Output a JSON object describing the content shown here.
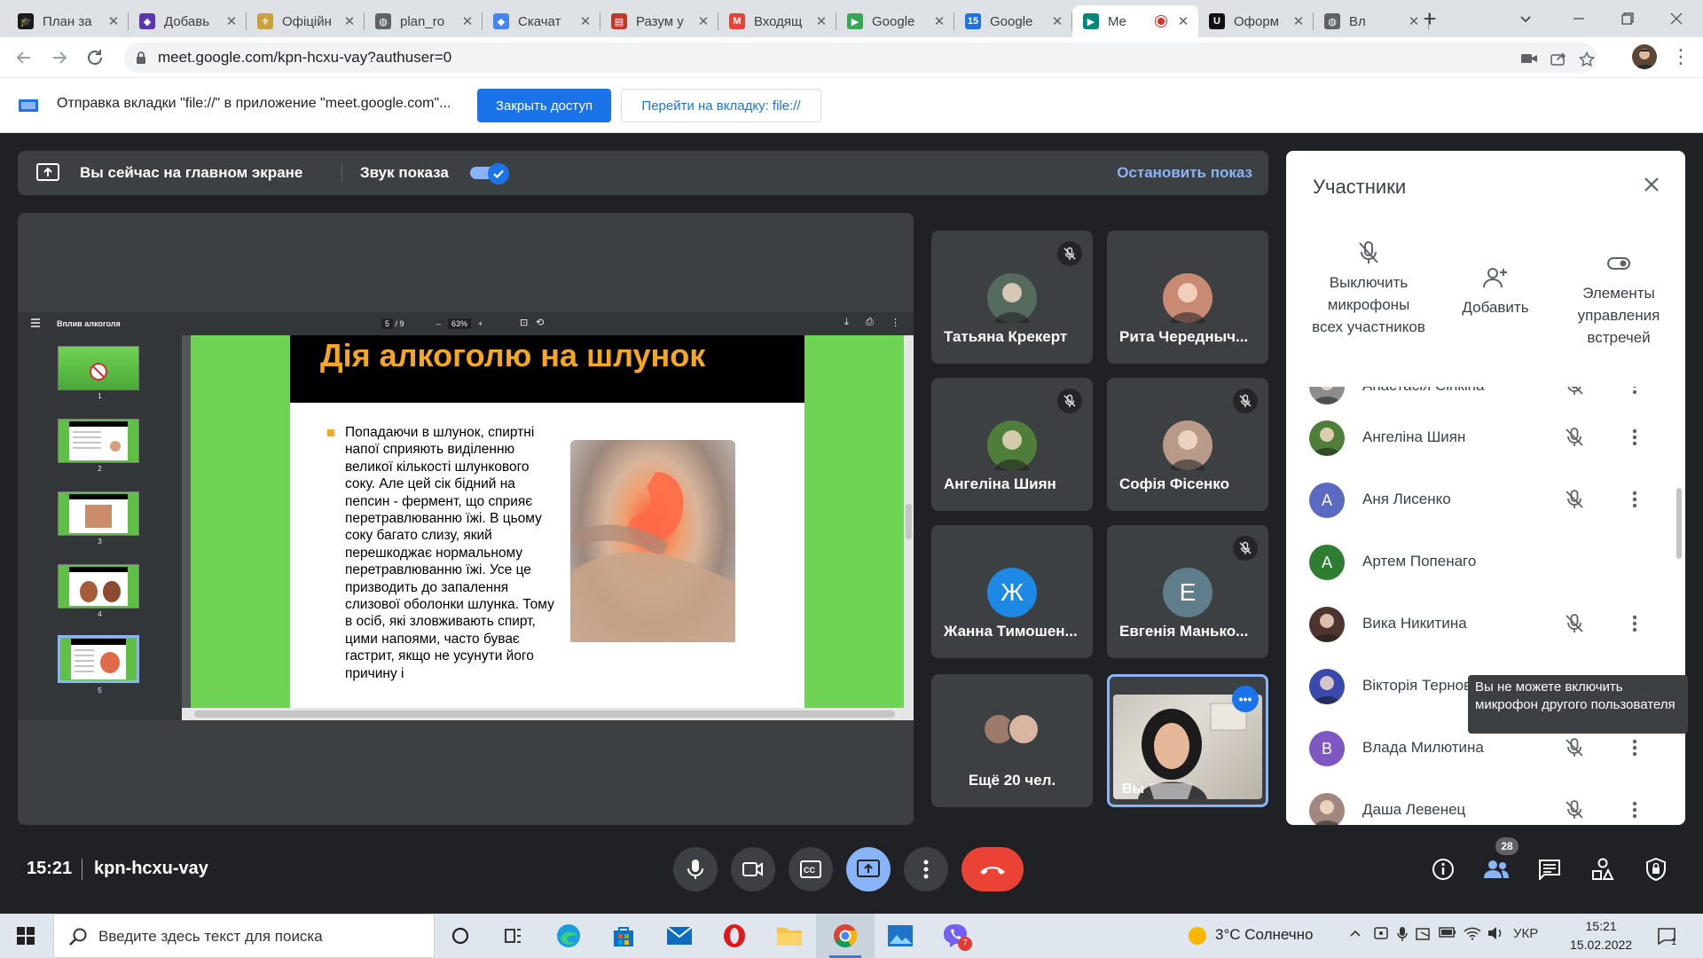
{
  "browser": {
    "tabs": [
      {
        "title": "План за",
        "color": "#1b1b1b",
        "glyph": "🎓"
      },
      {
        "title": "Добавь",
        "color": "#5e35b1",
        "glyph": "◆"
      },
      {
        "title": "Офіційн",
        "color": "#c8a13b",
        "glyph": "⚜"
      },
      {
        "title": "plan_ro",
        "color": "#5f6368",
        "glyph": "◍"
      },
      {
        "title": "Скачат",
        "color": "#4285f4",
        "glyph": "◆"
      },
      {
        "title": "Разум у",
        "color": "#c0392b",
        "glyph": "▤"
      },
      {
        "title": "Входящ",
        "color": "#ea4335",
        "glyph": "M"
      },
      {
        "title": "Google",
        "color": "#34a853",
        "glyph": "▶"
      },
      {
        "title": "Google",
        "color": "#1a73e8",
        "glyph": "15"
      },
      {
        "title": "Me",
        "color": "#00897b",
        "glyph": "▶",
        "active": true
      },
      {
        "title": "Оформ",
        "color": "#111111",
        "glyph": "U"
      },
      {
        "title": "Вл",
        "color": "#5f6368",
        "glyph": "◍"
      }
    ],
    "url": "meet.google.com/kpn-hcxu-vay?authuser=0"
  },
  "infobar": {
    "text": "Отправка вкладки \"file://\" в приложение \"meet.google.com\"...",
    "close_access": "Закрыть доступ",
    "goto_tab": "Перейти на вкладку: file://"
  },
  "meet": {
    "banner": {
      "status": "Вы сейчас на главном экране",
      "sound": "Звук показа",
      "stop": "Остановить показ"
    },
    "pdf": {
      "doc_title": "Вплив алкоголя",
      "page": "5",
      "page_total": "/ 9",
      "zoom": "63%",
      "thumb_numbers": [
        "1",
        "2",
        "3",
        "4",
        "5"
      ]
    },
    "slide": {
      "title": "Дія алкоголю на шлунок",
      "body": "Попадаючи в шлунок, спиртні напої сприяють виділенню великої кількості шлункового соку. Але цей сік бідний на пепсин - фермент, що сприяє перетравлюванню їжі. В цьому соку багато слизу, який перешкоджає нормальному перетравлюванню їжі. Усе це призводить до запалення слизової оболонки шлунка. Тому в осіб, які зловживають спирт, цими напоями, часто буває гастрит, якщо не усунути його причину і"
    },
    "tiles": [
      {
        "name": "Татьяна Крекерт",
        "muted": true,
        "avatar": "#556b5d",
        "letter": ""
      },
      {
        "name": "Рита Чередныч...",
        "muted": false,
        "avatar": "#c98a74",
        "letter": ""
      },
      {
        "name": "Ангеліна Шиян",
        "muted": true,
        "avatar": "#4f7d3a",
        "letter": ""
      },
      {
        "name": "Софія Фісенко",
        "muted": true,
        "avatar": "#b79a88",
        "letter": ""
      },
      {
        "name": "Жанна Тимошен...",
        "muted": false,
        "avatar": "#1e88e5",
        "letter": "Ж"
      },
      {
        "name": "Евгенія Манько...",
        "muted": true,
        "avatar": "#607d8b",
        "letter": "Е"
      }
    ],
    "more": "Ещё 20 чел.",
    "self": "Вы"
  },
  "panel": {
    "title": "Участники",
    "actions": {
      "mute_all": "Выключить микрофоны всех участников",
      "add": "Добавить",
      "controls": "Элементы управления встречей"
    },
    "list": [
      {
        "name": "Анастасія Сінкіна",
        "color": "#8d8d8d",
        "letter": "",
        "photo": true
      },
      {
        "name": "Ангеліна Шиян",
        "color": "#4f7d3a",
        "letter": "",
        "photo": true
      },
      {
        "name": "Аня Лисенко",
        "color": "#5c6bc0",
        "letter": "А",
        "photo": false
      },
      {
        "name": "Артем Попенаго",
        "color": "#2e7d32",
        "letter": "А",
        "photo": false
      },
      {
        "name": "Вика Никитина",
        "color": "#4e342e",
        "letter": "",
        "photo": true
      },
      {
        "name": "Вікторія Терновська",
        "color": "#3949ab",
        "letter": "",
        "photo": true
      },
      {
        "name": "Влада Милютина",
        "color": "#7e57c2",
        "letter": "В",
        "photo": false
      },
      {
        "name": "Даша Левенец",
        "color": "#a1887f",
        "letter": "",
        "photo": true
      }
    ],
    "tooltip": "Вы не можете включить микрофон другого пользователя"
  },
  "bottom": {
    "time": "15:21",
    "code": "kpn-hcxu-vay",
    "participants_count": "28"
  },
  "taskbar": {
    "search_placeholder": "Введите здесь текст для поиска",
    "weather": "3°C  Солнечно",
    "lang": "УКР",
    "time": "15:21",
    "date": "15.02.2022",
    "notif_count": "1",
    "viber_badge": "7"
  }
}
